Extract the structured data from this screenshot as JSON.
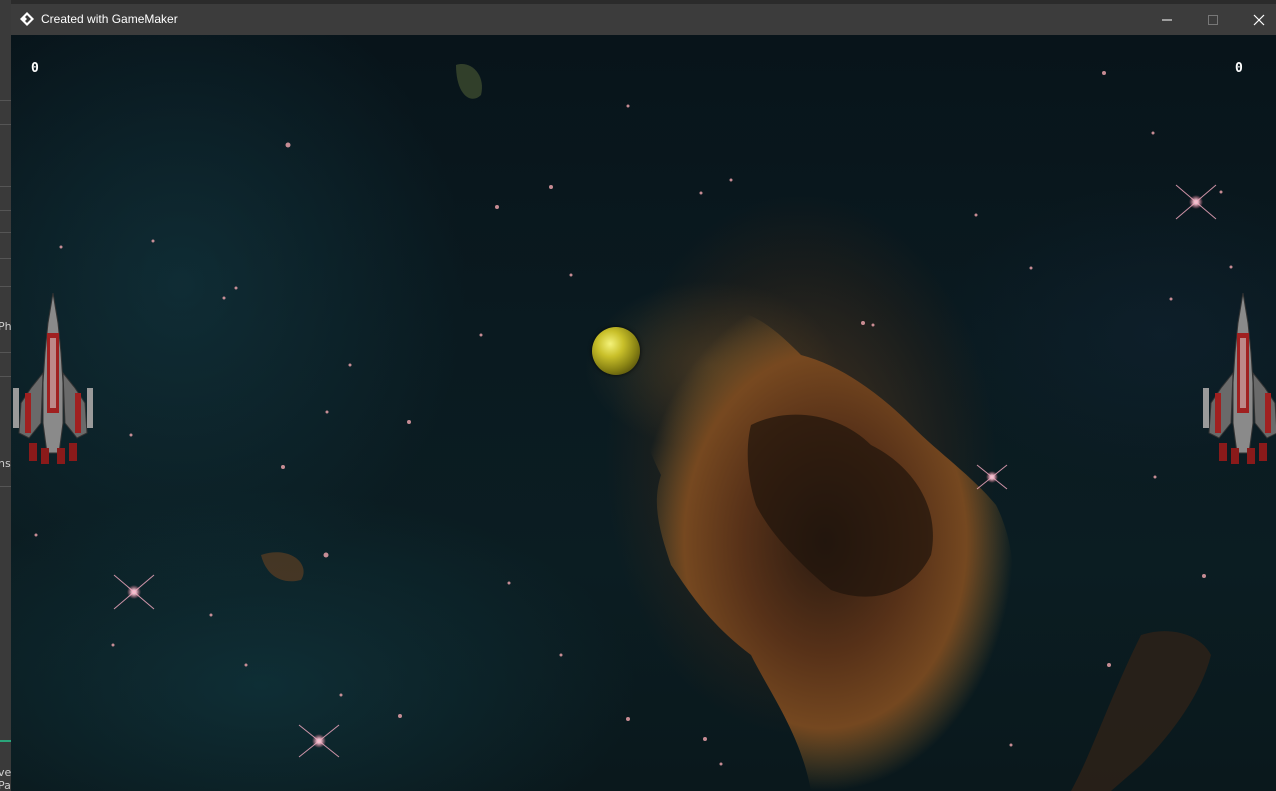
{
  "window": {
    "title": "Created with GameMaker",
    "minimize_icon": "minimize-icon",
    "maximize_icon": "maximize-icon",
    "close_icon": "close-icon",
    "app_icon": "gamemaker-logo-icon"
  },
  "background_editor": {
    "fragments": [
      "Ph",
      "ns",
      "ve",
      "Pa"
    ]
  },
  "game": {
    "score_left": "0",
    "score_right": "0",
    "left_paddle": "spaceship-left",
    "right_paddle": "spaceship-right",
    "ball": "planet-ball"
  }
}
